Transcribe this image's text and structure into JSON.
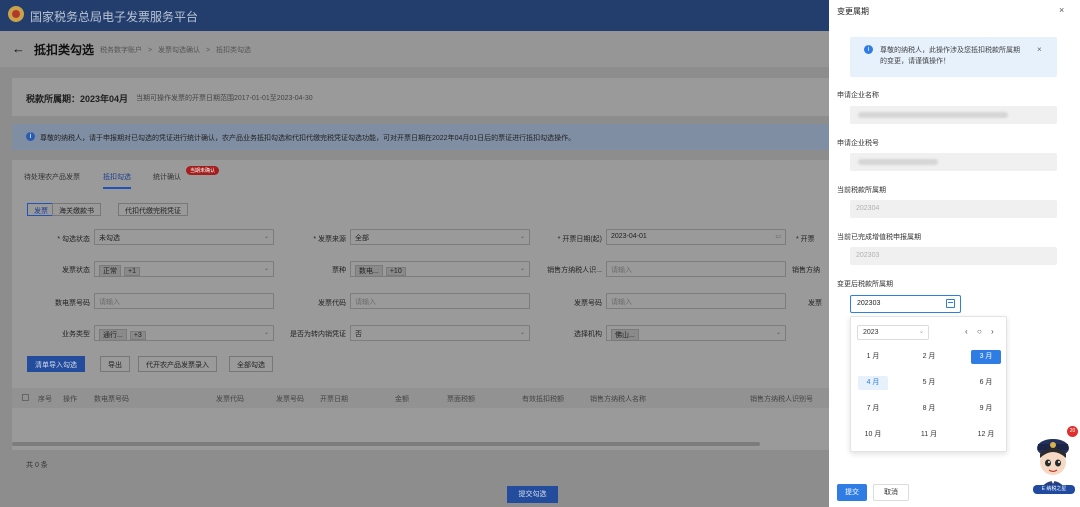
{
  "app": {
    "title": "国家税务总局电子发票服务平台"
  },
  "header": {
    "back_icon": "←",
    "page_title": "抵扣类勾选",
    "breadcrumbs": [
      "税务数字账户",
      ">",
      "发票勾选确认",
      ">",
      "抵扣类勾选"
    ]
  },
  "period": {
    "label": "税款所属期：2023年04月",
    "range": "当期可操作发票的开票日期范围2017-01-01至2023-04-30"
  },
  "notice": {
    "text": "尊敬的纳税人，请于申报期对已勾选的凭证进行统计确认，农产品业务抵扣勾选和代扣代缴完税凭证勾选功能，可对开票日期在2022年04月01日后的票证进行抵扣勾选操作。"
  },
  "tabs": [
    {
      "label": "待处理农产品发票"
    },
    {
      "label": "抵扣勾选"
    },
    {
      "label": "统计确认"
    }
  ],
  "tab_badge": "当期未确认",
  "segments": [
    "发票",
    "海关缴款书",
    "代扣代缴完税凭证"
  ],
  "filters": {
    "status_label": "* 勾选状态",
    "status_value": "未勾选",
    "source_label": "* 发票来源",
    "source_value": "全部",
    "date_label": "* 开票日期(起)",
    "date_value": "2023-04-01",
    "date_end_label": "* 开票",
    "inv_status_label": "发票状态",
    "inv_status_tag": "正常",
    "inv_status_more": "+1",
    "kind_label": "票种",
    "kind_tag": "数电...",
    "kind_more": "+10",
    "seller_id_label": "销售方纳税人识...",
    "seller_id_ph": "请输入",
    "seller_name_label": "销售方纳",
    "digital_no_label": "数电票号码",
    "digital_no_ph": "请输入",
    "code_label": "发票代码",
    "code_ph": "请输入",
    "num_label": "发票号码",
    "num_ph": "请输入",
    "extra_label": "发票",
    "biz_label": "业务类型",
    "biz_tag": "通行...",
    "biz_more": "+3",
    "transfer_label": "是否为转内销凭证",
    "transfer_value": "否",
    "org_label": "选择机构",
    "org_tag": "佛山..."
  },
  "actions": [
    "清单导入勾选",
    "导出",
    "代开农产品发票录入",
    "全部勾选"
  ],
  "table_headers": [
    "序号",
    "操作",
    "数电票号码",
    "发票代码",
    "发票号码",
    "开票日期",
    "金额",
    "票面税额",
    "有效抵扣税额",
    "销售方纳税人名称",
    "销售方纳税人识别号"
  ],
  "table_total": "共 0 条",
  "submit_main": "提交勾选",
  "drawer": {
    "title": "变更属期",
    "close": "×",
    "alert": "尊敬的纳税人，此操作涉及您抵扣税款所属期的变更，请谨慎操作！",
    "alert_close": "×",
    "company_name_label": "申请企业名称",
    "tax_id_label": "申请企业税号",
    "current_period_label": "当前税款所属期",
    "current_period_value": "202304",
    "completed_period_label": "当前已完成增值税申报属期",
    "completed_period_value": "202303",
    "new_period_label": "变更后税款所属期",
    "new_period_value": "202303",
    "submit": "提交",
    "cancel": "取消"
  },
  "picker": {
    "year": "2023",
    "months": [
      "1 月",
      "2 月",
      "3 月",
      "4 月",
      "5 月",
      "6 月",
      "7 月",
      "8 月",
      "9 月",
      "10 月",
      "11 月",
      "12 月"
    ],
    "selected_month": "3 月",
    "current_month": "4 月"
  },
  "mascot": {
    "badge": "20",
    "label": "E 纳税之星"
  }
}
